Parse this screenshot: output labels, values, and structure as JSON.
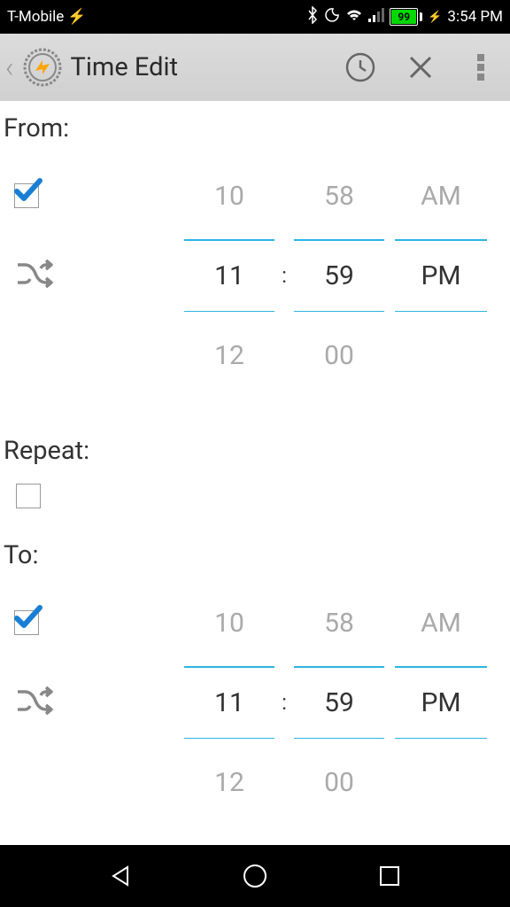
{
  "status": {
    "carrier": "T-Mobile",
    "battery": "99",
    "time": "3:54 PM"
  },
  "toolbar": {
    "title": "Time Edit"
  },
  "labels": {
    "from": "From:",
    "repeat": "Repeat:",
    "to": "To:"
  },
  "from": {
    "hour_above": "10",
    "min_above": "58",
    "ampm_above": "AM",
    "hour": "11",
    "min": "59",
    "ampm": "PM",
    "hour_below": "12",
    "min_below": "00",
    "colon": ":"
  },
  "to": {
    "hour_above": "10",
    "min_above": "58",
    "ampm_above": "AM",
    "hour": "11",
    "min": "59",
    "ampm": "PM",
    "hour_below": "12",
    "min_below": "00",
    "colon": ":"
  }
}
